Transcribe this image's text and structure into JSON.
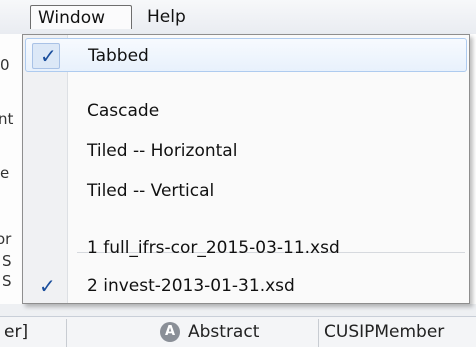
{
  "menubar": {
    "window_label": "Window",
    "help_label": "Help"
  },
  "background": {
    "fragments": [
      "0",
      "nt",
      "e",
      "or",
      "S",
      "S",
      "S"
    ],
    "row": {
      "left_text": "er]",
      "abstract_label": "Abstract",
      "member_label": "CUSIPMember"
    }
  },
  "window_menu": {
    "items": [
      {
        "label": "Tabbed",
        "checked": true
      },
      {
        "label": "Cascade",
        "checked": false
      },
      {
        "label": "Tiled -- Horizontal",
        "checked": false
      },
      {
        "label": "Tiled -- Vertical",
        "checked": false
      }
    ],
    "windows": [
      {
        "label": "1 full_ifrs-cor_2015-03-11.xsd",
        "checked": false
      },
      {
        "label": "2 invest-2013-01-31.xsd",
        "checked": true
      }
    ]
  },
  "colors": {
    "accent": "#1a4e9c",
    "highlight_border": "#aecbef"
  },
  "icons": {
    "check": "check-icon",
    "abstract": "abstract-icon"
  }
}
